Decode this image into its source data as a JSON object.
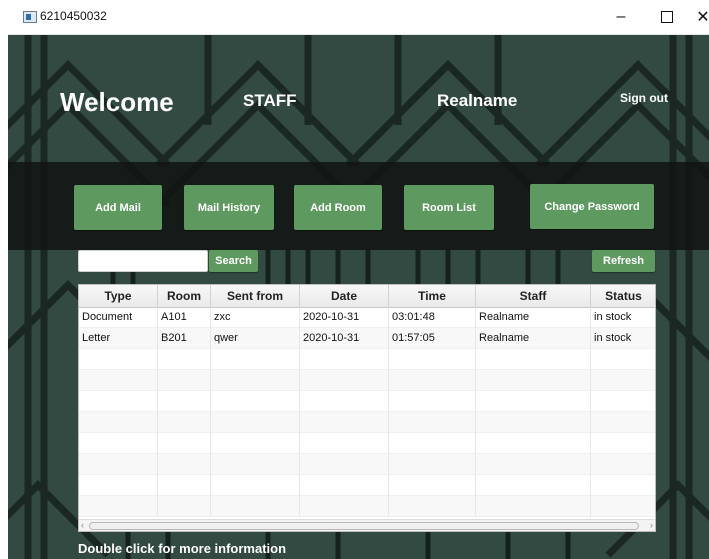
{
  "window": {
    "title": "6210450032",
    "minimize_glyph": "–",
    "close_glyph": "✕"
  },
  "header": {
    "welcome": "Welcome",
    "role": "STAFF",
    "user_name": "Realname",
    "sign_out": "Sign out"
  },
  "actions": {
    "add_mail": "Add Mail",
    "mail_history": "Mail History",
    "add_room": "Add Room",
    "room_list": "Room List",
    "change_password": "Change Password"
  },
  "search": {
    "value": "",
    "button": "Search"
  },
  "refresh": "Refresh",
  "table": {
    "columns": [
      "Type",
      "Room",
      "Sent from",
      "Date",
      "Time",
      "Staff",
      "Status"
    ],
    "rows": [
      [
        "Document",
        "A101",
        "zxc",
        "2020-10-31",
        "03:01:48",
        "Realname",
        "in stock"
      ],
      [
        "Letter",
        "B201",
        "qwer",
        "2020-10-31",
        "01:57:05",
        "Realname",
        "in stock"
      ]
    ],
    "empty_rows": 8
  },
  "hint": "Double click for more information",
  "colors": {
    "background": "#324a42",
    "button": "#5e9a60",
    "band": "#111412"
  }
}
